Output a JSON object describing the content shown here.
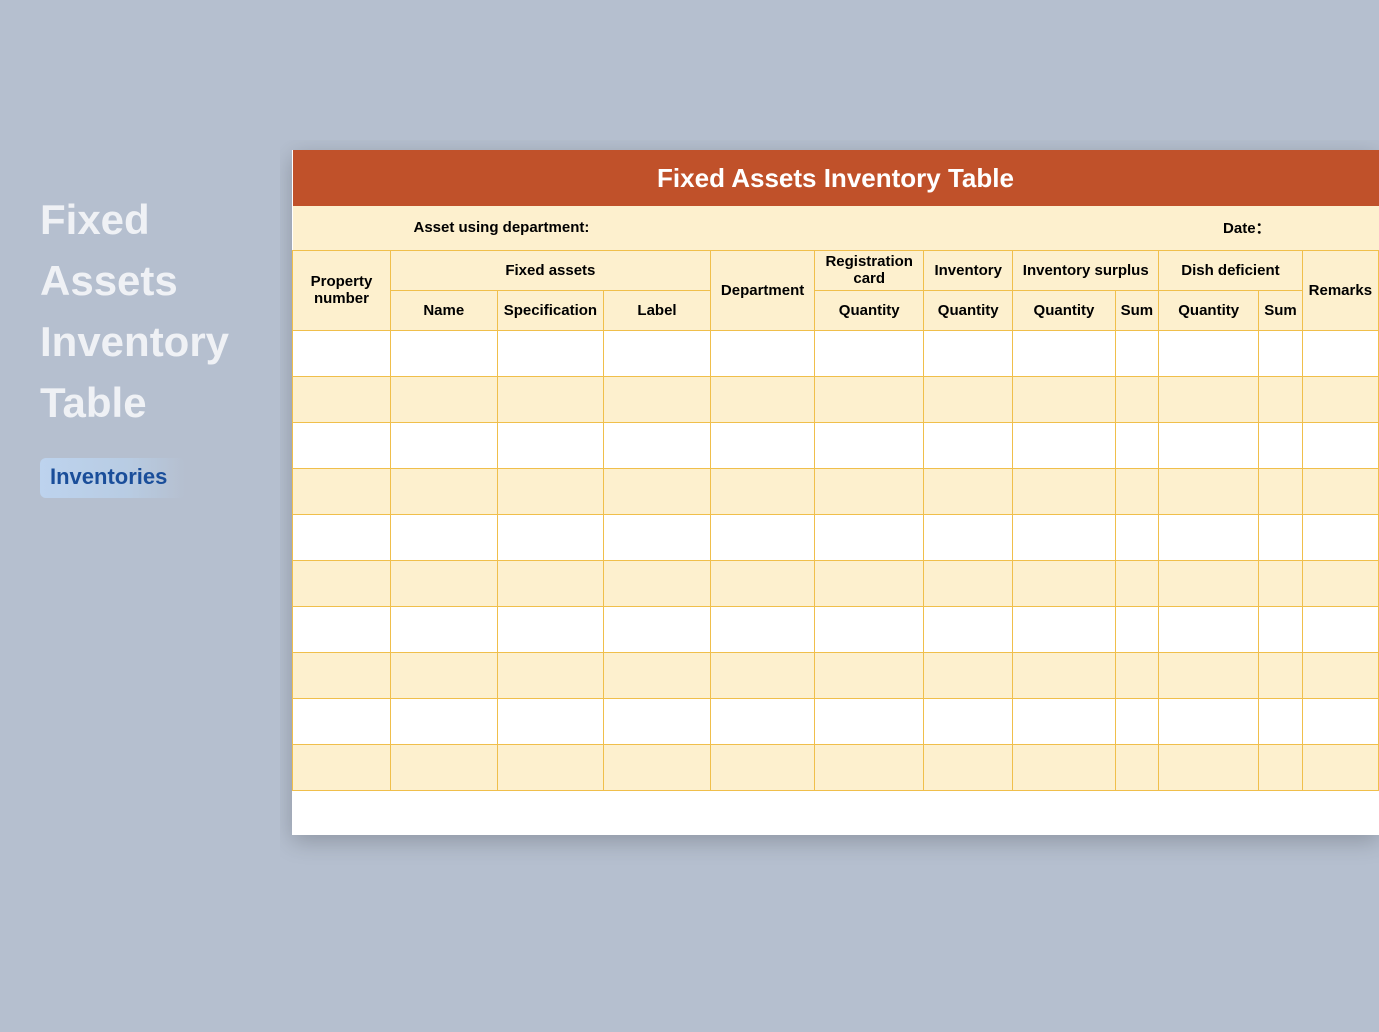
{
  "left": {
    "title_l1": "Fixed",
    "title_l2": "Assets",
    "title_l3": "Inventory",
    "title_l4": "Table",
    "tag": "Inventories"
  },
  "sheet": {
    "title": "Fixed Assets Inventory Table",
    "meta": {
      "department_label": "Asset using department:",
      "date_label": "Date："
    },
    "headers": {
      "property_number": "Property number",
      "fixed_assets": "Fixed assets",
      "name": "Name",
      "specification": "Specification",
      "label": "Label",
      "department": "Department",
      "registration_card": "Registration card",
      "quantity": "Quantity",
      "inventory": "Inventory",
      "inventory_surplus": "Inventory surplus",
      "sum": "Sum",
      "dish_deficient": "Dish deficient",
      "remarks": "Remarks"
    },
    "rows": [
      {
        "property_number": "",
        "name": "",
        "specification": "",
        "label": "",
        "department": "",
        "reg_qty": "",
        "inv_qty": "",
        "surplus_qty": "",
        "surplus_sum": "",
        "def_qty": "",
        "def_sum": "",
        "remarks": ""
      },
      {
        "property_number": "",
        "name": "",
        "specification": "",
        "label": "",
        "department": "",
        "reg_qty": "",
        "inv_qty": "",
        "surplus_qty": "",
        "surplus_sum": "",
        "def_qty": "",
        "def_sum": "",
        "remarks": ""
      },
      {
        "property_number": "",
        "name": "",
        "specification": "",
        "label": "",
        "department": "",
        "reg_qty": "",
        "inv_qty": "",
        "surplus_qty": "",
        "surplus_sum": "",
        "def_qty": "",
        "def_sum": "",
        "remarks": ""
      },
      {
        "property_number": "",
        "name": "",
        "specification": "",
        "label": "",
        "department": "",
        "reg_qty": "",
        "inv_qty": "",
        "surplus_qty": "",
        "surplus_sum": "",
        "def_qty": "",
        "def_sum": "",
        "remarks": ""
      },
      {
        "property_number": "",
        "name": "",
        "specification": "",
        "label": "",
        "department": "",
        "reg_qty": "",
        "inv_qty": "",
        "surplus_qty": "",
        "surplus_sum": "",
        "def_qty": "",
        "def_sum": "",
        "remarks": ""
      },
      {
        "property_number": "",
        "name": "",
        "specification": "",
        "label": "",
        "department": "",
        "reg_qty": "",
        "inv_qty": "",
        "surplus_qty": "",
        "surplus_sum": "",
        "def_qty": "",
        "def_sum": "",
        "remarks": ""
      },
      {
        "property_number": "",
        "name": "",
        "specification": "",
        "label": "",
        "department": "",
        "reg_qty": "",
        "inv_qty": "",
        "surplus_qty": "",
        "surplus_sum": "",
        "def_qty": "",
        "def_sum": "",
        "remarks": ""
      },
      {
        "property_number": "",
        "name": "",
        "specification": "",
        "label": "",
        "department": "",
        "reg_qty": "",
        "inv_qty": "",
        "surplus_qty": "",
        "surplus_sum": "",
        "def_qty": "",
        "def_sum": "",
        "remarks": ""
      },
      {
        "property_number": "",
        "name": "",
        "specification": "",
        "label": "",
        "department": "",
        "reg_qty": "",
        "inv_qty": "",
        "surplus_qty": "",
        "surplus_sum": "",
        "def_qty": "",
        "def_sum": "",
        "remarks": ""
      },
      {
        "property_number": "",
        "name": "",
        "specification": "",
        "label": "",
        "department": "",
        "reg_qty": "",
        "inv_qty": "",
        "surplus_qty": "",
        "surplus_sum": "",
        "def_qty": "",
        "def_sum": "",
        "remarks": ""
      }
    ]
  }
}
